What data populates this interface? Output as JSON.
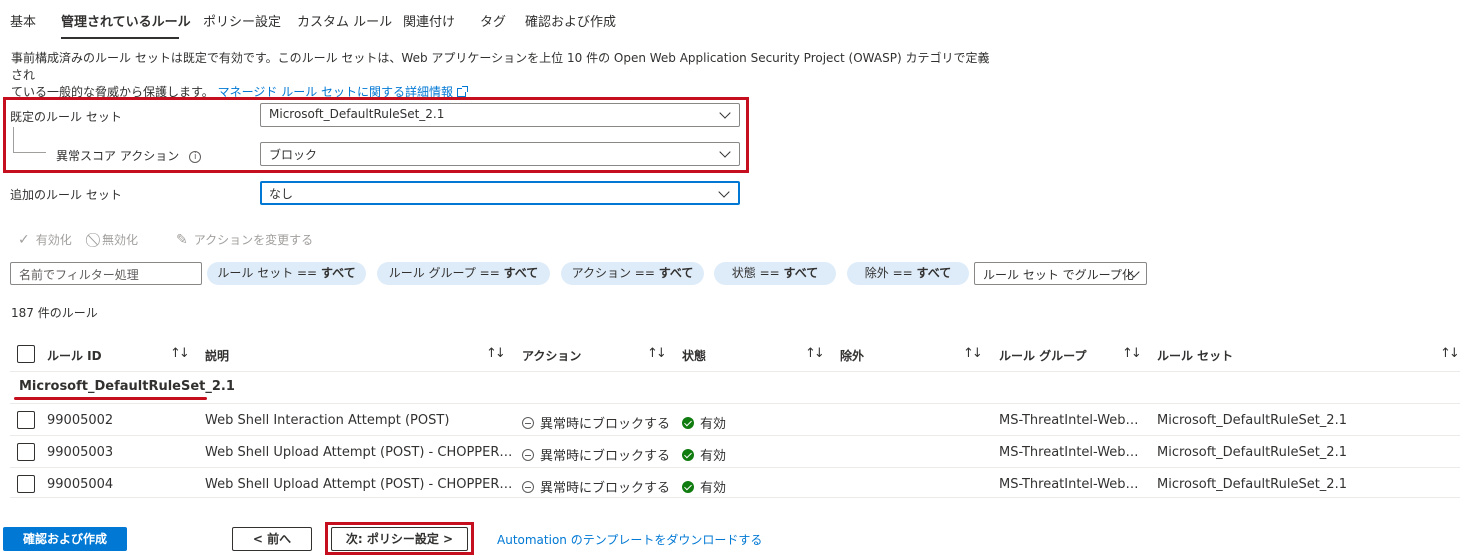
{
  "tabs": [
    {
      "label": "基本"
    },
    {
      "label": "管理されているルール"
    },
    {
      "label": "ポリシー設定"
    },
    {
      "label": "カスタム ルール"
    },
    {
      "label": "関連付け"
    },
    {
      "label": "タグ"
    },
    {
      "label": "確認および作成"
    }
  ],
  "description": {
    "line1": "事前構成済みのルール セットは既定で有効です。このルール セットは、Web アプリケーションを上位 10 件の Open Web Application Security Project (OWASP) カテゴリで定義され",
    "line2": "ている一般的な脅威から保護します。",
    "link": "マネージド ルール セットに関する詳細情報"
  },
  "form": {
    "default_ruleset_label": "既定のルール セット",
    "default_ruleset_value": "Microsoft_DefaultRuleSet_2.1",
    "anomaly_action_label": "異常スコア アクション",
    "anomaly_action_value": "ブロック",
    "additional_ruleset_label": "追加のルール セット",
    "additional_ruleset_value": "なし"
  },
  "toolbar": {
    "enable": "有効化",
    "disable": "無効化",
    "change_action": "アクションを変更する"
  },
  "filters": {
    "search_placeholder": "名前でフィルター処理",
    "pills": [
      {
        "key": "ルール セット == ",
        "value": "すべて"
      },
      {
        "key": "ルール グループ == ",
        "value": "すべて"
      },
      {
        "key": "アクション == ",
        "value": "すべて"
      },
      {
        "key": "状態 == ",
        "value": "すべて"
      },
      {
        "key": "除外 == ",
        "value": "すべて"
      }
    ],
    "group_by": "ルール セット でグループ化"
  },
  "rule_count": "187 件のルール",
  "table": {
    "headers": [
      "ルール ID",
      "説明",
      "アクション",
      "状態",
      "除外",
      "ルール グループ",
      "ルール セット"
    ],
    "group_name": "Microsoft_DefaultRuleSet_2.1",
    "rows": [
      {
        "id": "99005002",
        "description": "Web Shell Interaction Attempt (POST)",
        "action": "異常時にブロックする",
        "state": "有効",
        "exclusion": "",
        "group": "MS-ThreatIntel-Web…",
        "ruleset": "Microsoft_DefaultRuleSet_2.1"
      },
      {
        "id": "99005003",
        "description": "Web Shell Upload Attempt (POST) - CHOPPER…",
        "action": "異常時にブロックする",
        "state": "有効",
        "exclusion": "",
        "group": "MS-ThreatIntel-Web…",
        "ruleset": "Microsoft_DefaultRuleSet_2.1"
      },
      {
        "id": "99005004",
        "description": "Web Shell Upload Attempt (POST) - CHOPPER…",
        "action": "異常時にブロックする",
        "state": "有効",
        "exclusion": "",
        "group": "MS-ThreatIntel-Web…",
        "ruleset": "Microsoft_DefaultRuleSet_2.1"
      }
    ]
  },
  "footer": {
    "review_create": "確認および作成",
    "previous": "< 前へ",
    "next": "次: ポリシー設定 >",
    "download_link": "Automation のテンプレートをダウンロードする"
  },
  "colors": {
    "accent": "#0078d4",
    "highlight": "#c50f1f",
    "enabled": "#107c10",
    "pill_bg": "#deecf9"
  }
}
